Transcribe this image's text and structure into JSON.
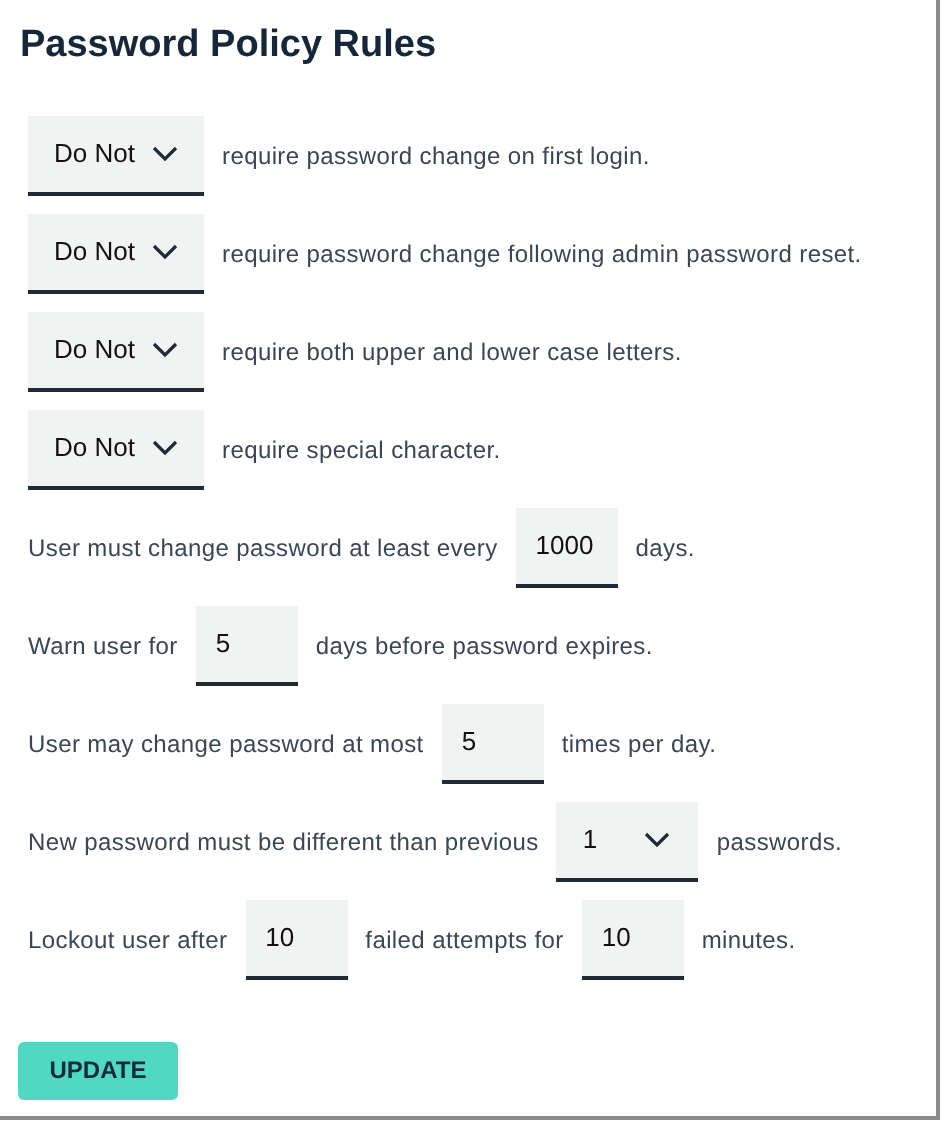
{
  "title": "Password Policy Rules",
  "rules": [
    {
      "parts": [
        {
          "kind": "select",
          "value": "Do Not"
        },
        {
          "kind": "text",
          "text": "require password change on first login."
        }
      ]
    },
    {
      "parts": [
        {
          "kind": "select",
          "value": "Do Not"
        },
        {
          "kind": "text",
          "text": "require password change following admin password reset."
        }
      ]
    },
    {
      "parts": [
        {
          "kind": "select",
          "value": "Do Not"
        },
        {
          "kind": "text",
          "text": "require both upper and lower case letters."
        }
      ]
    },
    {
      "parts": [
        {
          "kind": "select",
          "value": "Do Not"
        },
        {
          "kind": "text",
          "text": "require special character."
        }
      ]
    },
    {
      "parts": [
        {
          "kind": "text",
          "text": "User must change password at least every"
        },
        {
          "kind": "input",
          "value": "1000"
        },
        {
          "kind": "text",
          "text": "days."
        }
      ]
    },
    {
      "parts": [
        {
          "kind": "text",
          "text": "Warn user for"
        },
        {
          "kind": "input",
          "value": "5"
        },
        {
          "kind": "text",
          "text": "days before password expires."
        }
      ]
    },
    {
      "parts": [
        {
          "kind": "text",
          "text": "User may change password at most"
        },
        {
          "kind": "input",
          "value": "5"
        },
        {
          "kind": "text",
          "text": "times per day."
        }
      ]
    },
    {
      "parts": [
        {
          "kind": "text",
          "text": "New password must be different than previous"
        },
        {
          "kind": "number-select",
          "value": "1"
        },
        {
          "kind": "text",
          "text": "passwords."
        }
      ]
    },
    {
      "parts": [
        {
          "kind": "text",
          "text": "Lockout user after"
        },
        {
          "kind": "input",
          "value": "10"
        },
        {
          "kind": "text",
          "text": "failed attempts for"
        },
        {
          "kind": "input",
          "value": "10"
        },
        {
          "kind": "text",
          "text": "minutes."
        }
      ]
    }
  ],
  "button": "UPDATE"
}
